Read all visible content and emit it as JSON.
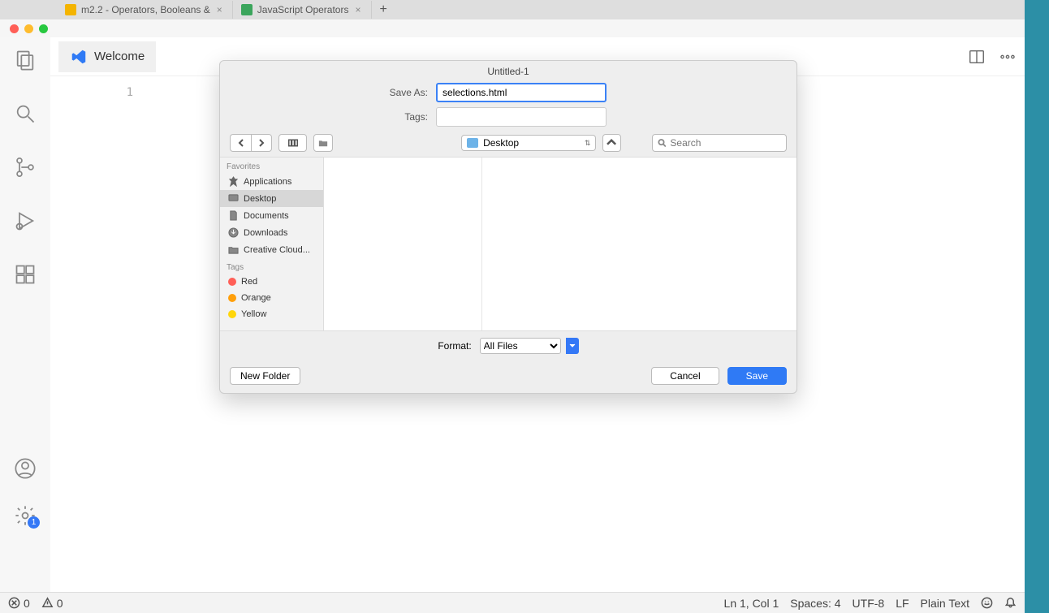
{
  "browser_tabs": [
    {
      "label": "m2.2 - Operators, Booleans &",
      "favicon_color": "#f4b400"
    },
    {
      "label": "JavaScript Operators",
      "favicon_color": "#3ba55c"
    }
  ],
  "vscode": {
    "tab_label": "Welcome",
    "line_number": "1"
  },
  "editor_actions": {},
  "dialog": {
    "title": "Untitled-1",
    "save_as_label": "Save As:",
    "save_as_value": "selections.html",
    "tags_label": "Tags:",
    "tags_value": "",
    "location": "Desktop",
    "search_placeholder": "Search",
    "sidebar": {
      "favorites_header": "Favorites",
      "items": [
        {
          "label": "Applications"
        },
        {
          "label": "Desktop"
        },
        {
          "label": "Documents"
        },
        {
          "label": "Downloads"
        },
        {
          "label": "Creative Cloud..."
        }
      ],
      "tags_header": "Tags",
      "tags": [
        {
          "label": "Red",
          "color": "#ff5f57"
        },
        {
          "label": "Orange",
          "color": "#ff9f0a"
        },
        {
          "label": "Yellow",
          "color": "#ffd60a"
        }
      ]
    },
    "format_label": "Format:",
    "format_value": "All Files",
    "new_folder": "New Folder",
    "cancel": "Cancel",
    "save": "Save"
  },
  "statusbar": {
    "errors": "0",
    "warnings": "0",
    "cursor": "Ln 1, Col 1",
    "spaces": "Spaces: 4",
    "encoding": "UTF-8",
    "eol": "LF",
    "language": "Plain Text"
  },
  "settings_badge": "1"
}
